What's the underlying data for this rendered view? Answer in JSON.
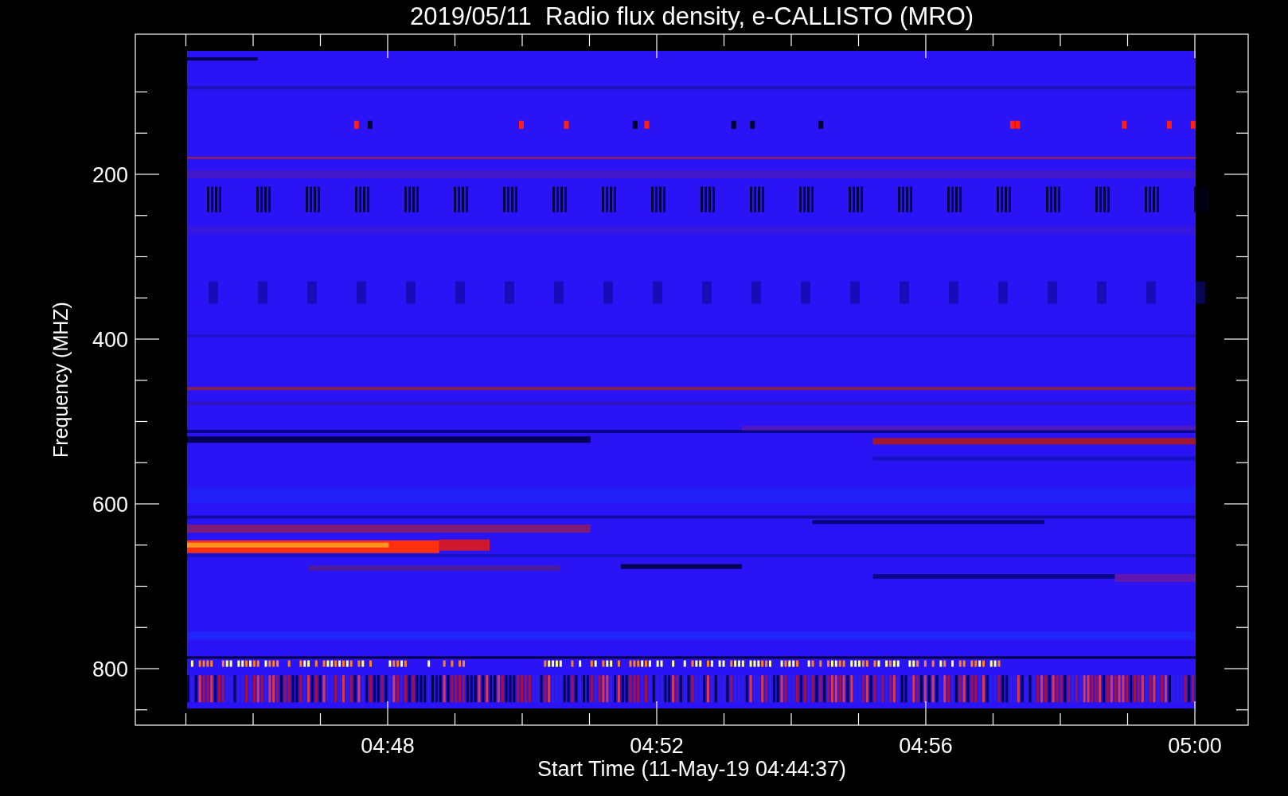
{
  "title": "2019/05/11  Radio flux density, e-CALLISTO (MRO)",
  "y_axis": {
    "label": "Frequency (MHZ)",
    "ticks": [
      "200",
      "400",
      "600",
      "800"
    ]
  },
  "x_axis": {
    "label": "Start Time (11-May-19 04:44:37)",
    "ticks": [
      "04:48",
      "04:52",
      "04:56",
      "05:00"
    ]
  }
}
